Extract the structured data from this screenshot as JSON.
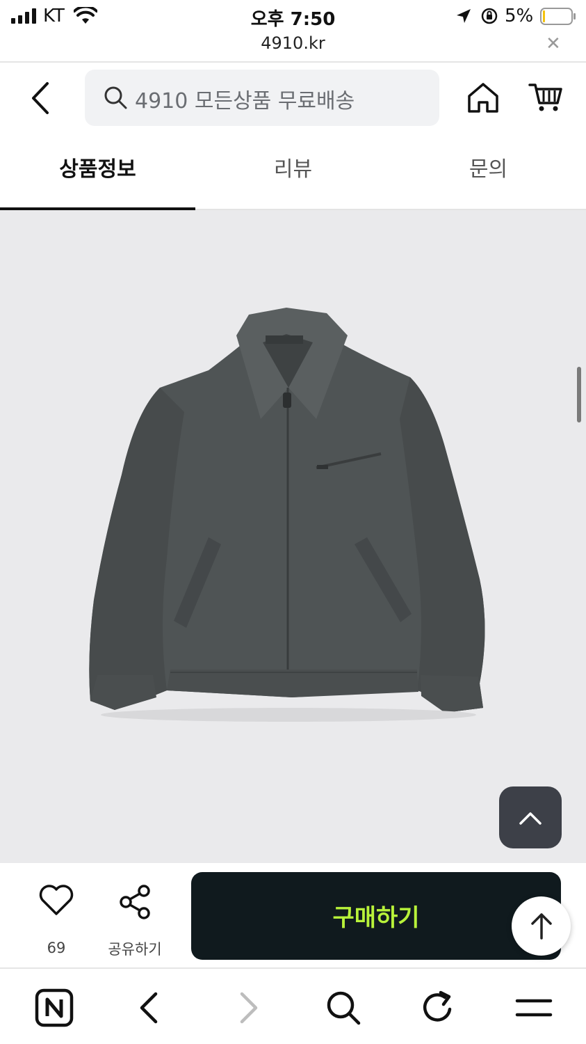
{
  "status_bar": {
    "carrier": "KT",
    "time": "오후 7:50",
    "battery": "5%",
    "battery_level": 0.05
  },
  "browser": {
    "url": "4910.kr",
    "close_icon": "close-icon"
  },
  "header": {
    "back_icon": "chevron-left-icon",
    "search_placeholder": "4910 모든상품 무료배송",
    "home_icon": "home-icon",
    "cart_icon": "cart-icon"
  },
  "tabs": [
    {
      "label": "상품정보",
      "active": true
    },
    {
      "label": "리뷰",
      "active": false
    },
    {
      "label": "문의",
      "active": false
    }
  ],
  "product_image": {
    "alt_icon": "jacket-image",
    "background": "#eaeaec",
    "jacket_color": "#4f5455"
  },
  "purchase_bar": {
    "like_count": "69",
    "share_label": "공유하기",
    "buy_label": "구매하기",
    "buy_bg": "#101a1e",
    "buy_text_color": "#b8f23a"
  },
  "toolbar": {
    "icons": [
      "naver-n-icon",
      "back-arrow-icon",
      "forward-arrow-icon",
      "search-icon",
      "refresh-icon",
      "menu-icon"
    ]
  }
}
